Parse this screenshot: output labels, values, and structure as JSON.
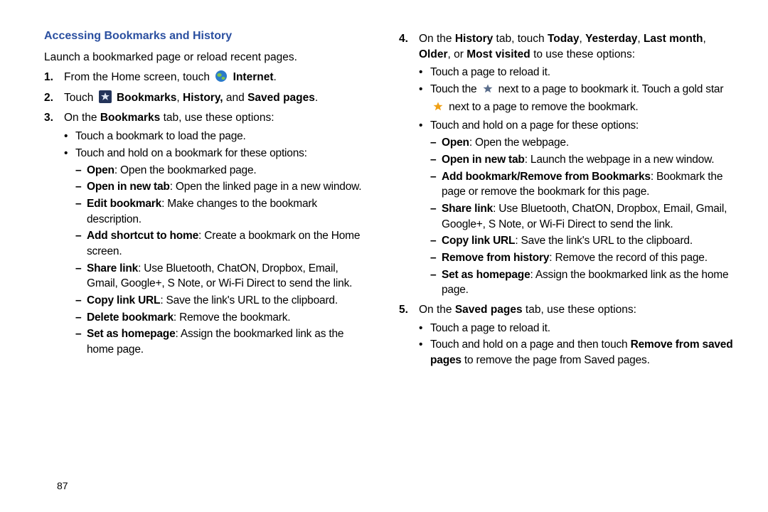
{
  "section_title": "Accessing Bookmarks and History",
  "intro": "Launch a bookmarked page or reload recent pages.",
  "page_number": "87",
  "step1": {
    "num": "1.",
    "before": "From the Home screen, touch ",
    "after_bold": "Internet",
    "end": "."
  },
  "step2": {
    "num": "2.",
    "pre": "Touch ",
    "b1": "Bookmarks",
    "c1": ", ",
    "b2": "History,",
    "between": " and ",
    "b3": "Saved pages",
    "end": "."
  },
  "step3": {
    "num": "3.",
    "pre": "On the ",
    "b": "Bookmarks",
    "post": " tab, use these options:"
  },
  "s3_bullets": {
    "b1": "Touch a bookmark to load the page.",
    "b2": "Touch and hold on a bookmark for these options:"
  },
  "s3_dashes": {
    "d1b": "Open",
    "d1r": ": Open the bookmarked page.",
    "d2b": "Open in new tab",
    "d2r": ": Open the linked page in a new window.",
    "d3b": "Edit bookmark",
    "d3r": ": Make changes to the bookmark description.",
    "d4b": "Add shortcut to home",
    "d4r": ": Create a bookmark on the Home screen.",
    "d5b": "Share link",
    "d5r": ": Use Bluetooth, ChatON, Dropbox, Email, Gmail, Google+, S Note, or Wi-Fi Direct to send the link.",
    "d6b": "Copy link URL",
    "d6r": ": Save the link's URL to the clipboard.",
    "d7b": "Delete bookmark",
    "d7r": ": Remove the bookmark.",
    "d8b": "Set as homepage",
    "d8r": ": Assign the bookmarked link as the home page."
  },
  "step4": {
    "num": "4.",
    "pre": "On the ",
    "b_tab": "History",
    "mid1": " tab, touch ",
    "b_today": "Today",
    "c1": ", ",
    "b_yest": "Yesterday",
    "c2": ", ",
    "b_lm": "Last month",
    "c3": ", ",
    "b_older": "Older",
    "c4": ", or ",
    "b_mv": "Most visited",
    "post": " to use these options:"
  },
  "s4_bullets": {
    "b1": "Touch a page to reload it.",
    "b2a": "Touch the",
    "b2b": "next to a page to bookmark it. Touch a gold star",
    "b2c": "next to a page to remove the bookmark.",
    "b3": "Touch and hold on a page for these options:"
  },
  "s4_dashes": {
    "d1b": "Open",
    "d1r": ": Open the webpage.",
    "d2b": "Open in new tab",
    "d2r": ": Launch the webpage in a new window.",
    "d3b": "Add bookmark/Remove from Bookmarks",
    "d3r": ": Bookmark the page or remove the bookmark for this page.",
    "d4b": "Share link",
    "d4r": ": Use Bluetooth, ChatON, Dropbox, Email, Gmail, Google+, S Note, or Wi-Fi Direct to send the link.",
    "d5b": "Copy link URL",
    "d5r": ": Save the link's URL to the clipboard.",
    "d6b": "Remove from history",
    "d6r": ": Remove the record of this page.",
    "d7b": "Set as homepage",
    "d7r": ": Assign the bookmarked link as the home page."
  },
  "step5": {
    "num": "5.",
    "pre": "On the ",
    "b": "Saved pages",
    "post": " tab, use these options:"
  },
  "s5_bullets": {
    "b1": "Touch a page to reload it.",
    "b2a": "Touch and hold on a page and then touch ",
    "b2b": "Remove from saved pages",
    "b2c": " to remove the page from Saved pages."
  }
}
